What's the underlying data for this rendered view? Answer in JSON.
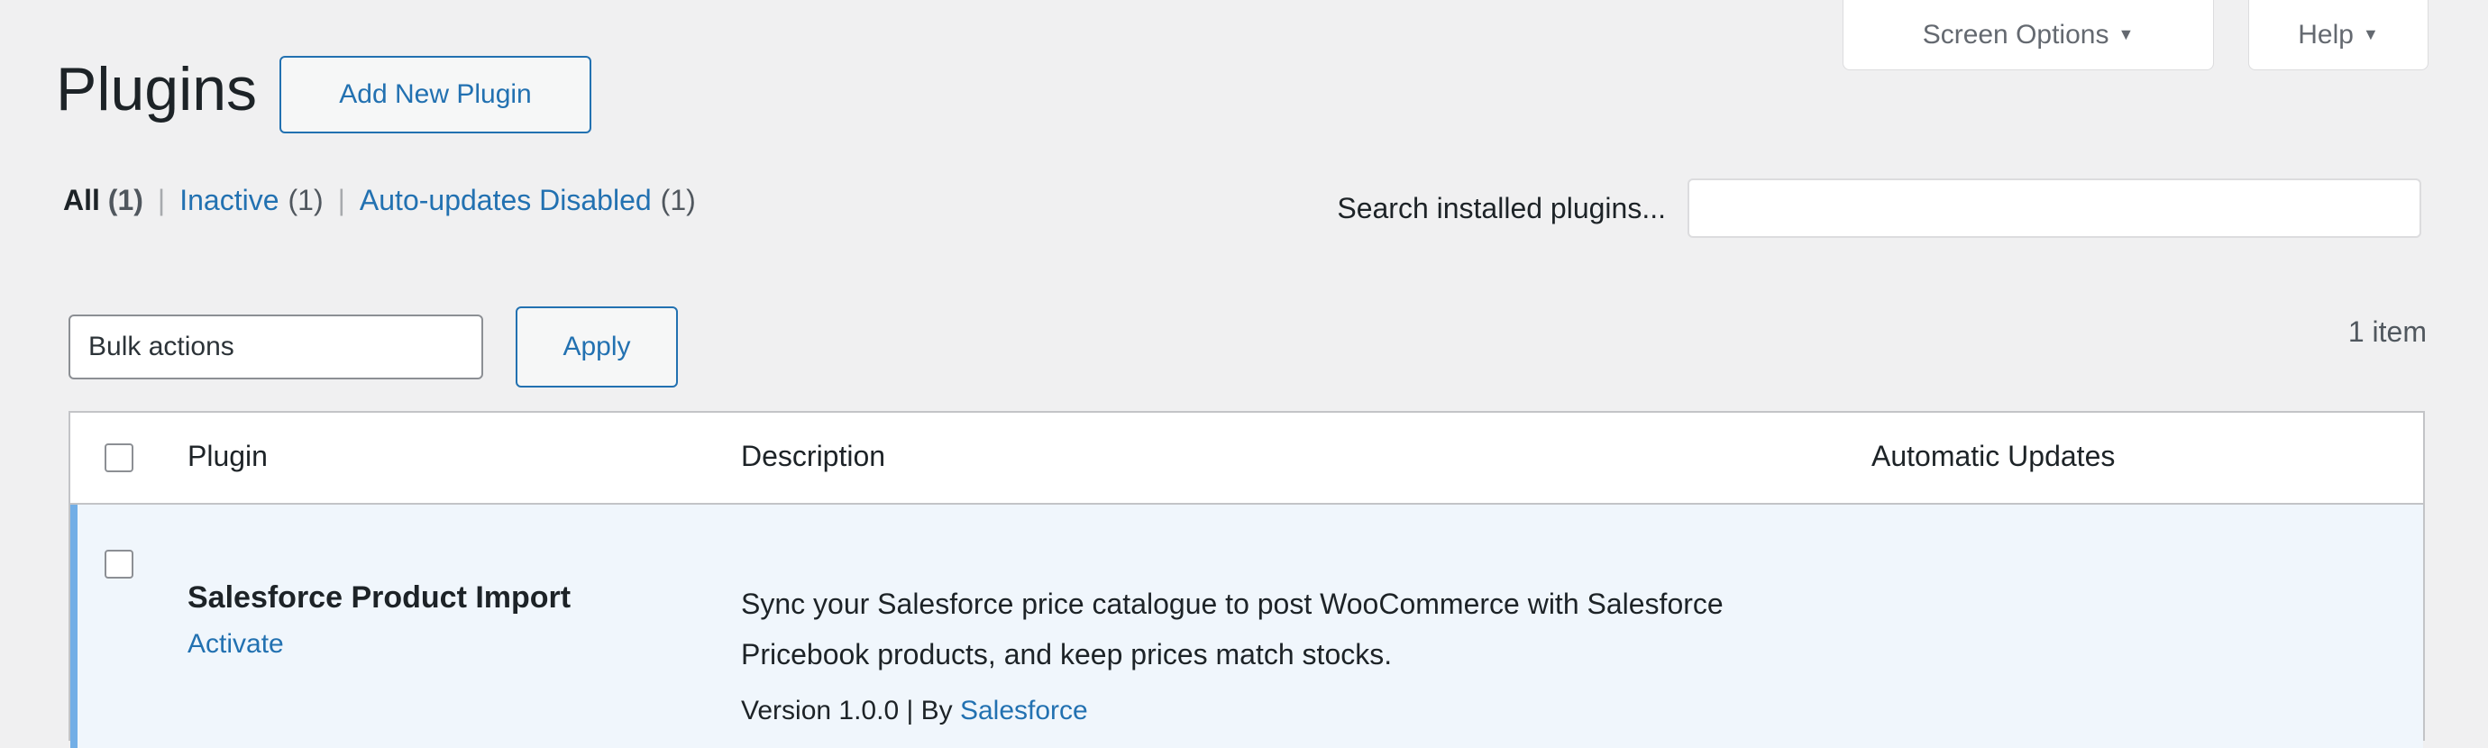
{
  "header": {
    "screen_options": "Screen Options",
    "help": "Help",
    "title": "Plugins",
    "add_new": "Add New Plugin"
  },
  "filters": {
    "all_label": "All",
    "all_count": "(1)",
    "inactive_label": "Inactive",
    "inactive_count": "(1)",
    "auto_updates_label": "Auto-updates Disabled",
    "auto_updates_count": "(1)"
  },
  "search": {
    "label": "Search installed plugins...",
    "value": ""
  },
  "bulk": {
    "select_label": "Bulk actions",
    "apply_label": "Apply",
    "item_count": "1 item"
  },
  "table": {
    "columns": [
      "Plugin",
      "Description",
      "Automatic Updates"
    ],
    "rows": [
      {
        "name": "Salesforce Product Import",
        "action": "Activate",
        "description": "Sync your Salesforce price catalogue to post WooCommerce with Salesforce Pricebook products, and keep prices match stocks.",
        "version_prefix": "Version 1.0.0 | By",
        "author": "Salesforce"
      }
    ]
  }
}
